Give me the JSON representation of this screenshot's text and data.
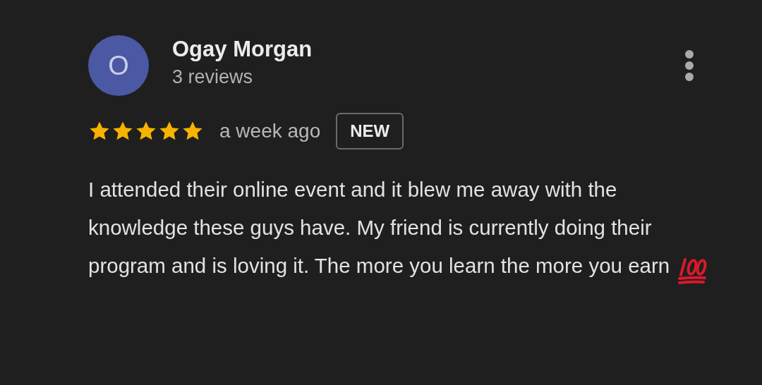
{
  "review": {
    "avatar_letter": "O",
    "author": "Ogay Morgan",
    "author_meta": "3 reviews",
    "stars": 5,
    "time": "a week ago",
    "badge": "NEW",
    "text": "I attended their online event and it blew me away with the knowledge these guys have. My friend is currently doing their program and is loving it. The more you learn the more you earn"
  }
}
